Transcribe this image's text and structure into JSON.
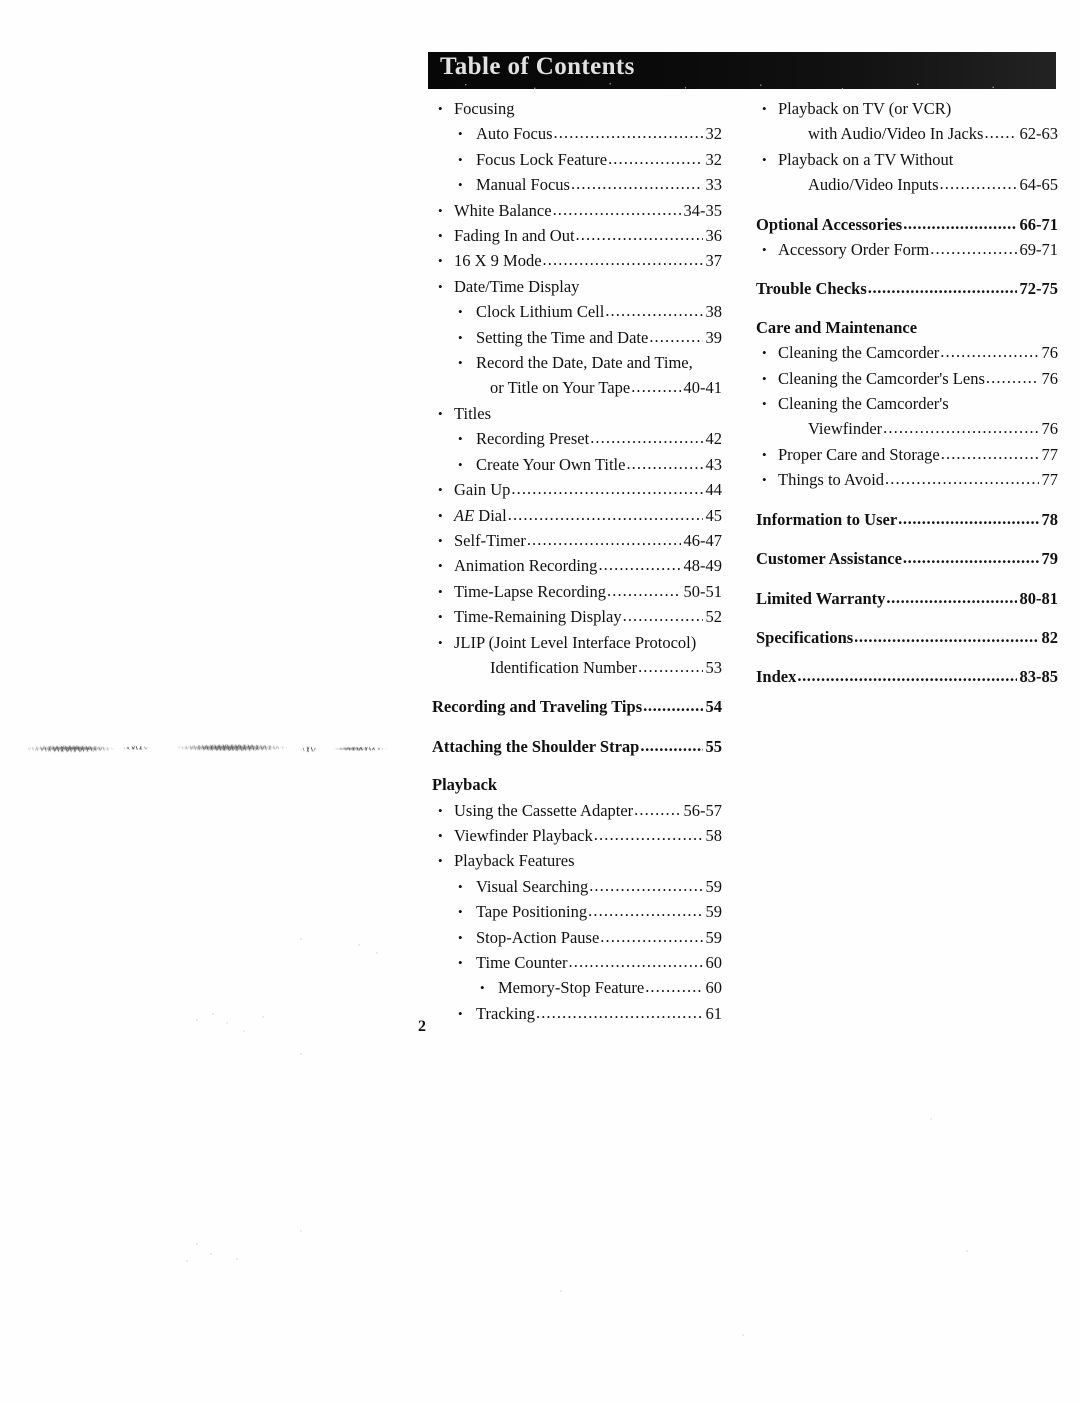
{
  "document": {
    "banner_title": "Table of Contents",
    "folio": "2",
    "leader_dots": "................................................................................................"
  },
  "left_column": [
    {
      "level": 1,
      "label": "Focusing",
      "page": ""
    },
    {
      "level": 2,
      "label": "Auto Focus",
      "page": "32"
    },
    {
      "level": 2,
      "label": "Focus Lock Feature",
      "page": "32"
    },
    {
      "level": 2,
      "label": "Manual Focus",
      "page": "33"
    },
    {
      "level": 1,
      "label": "White Balance",
      "page": "34-35"
    },
    {
      "level": 1,
      "label": "Fading In and Out",
      "page": "36"
    },
    {
      "level": 1,
      "label": "16 X 9 Mode",
      "page": "37"
    },
    {
      "level": 1,
      "label": "Date/Time Display",
      "page": ""
    },
    {
      "level": 2,
      "label": "Clock Lithium Cell",
      "page": "38"
    },
    {
      "level": 2,
      "label": "Setting the Time and Date",
      "page": "39"
    },
    {
      "level": 2,
      "label": "Record the Date, Date and  Time,",
      "page": ""
    },
    {
      "level": 0,
      "style": "cont",
      "label": "or Title on Your Tape",
      "page": "40-41"
    },
    {
      "level": 1,
      "label": "Titles",
      "page": ""
    },
    {
      "level": 2,
      "label": "Recording Preset",
      "page": "42"
    },
    {
      "level": 2,
      "label": "Create Your Own Title",
      "page": "43"
    },
    {
      "level": 1,
      "label": "Gain Up",
      "page": "44"
    },
    {
      "level": 1,
      "label_italic": "AE",
      "label": " Dial",
      "page": "45"
    },
    {
      "level": 1,
      "label": "Self-Timer",
      "page": "46-47"
    },
    {
      "level": 1,
      "label": "Animation Recording",
      "page": "48-49"
    },
    {
      "level": 1,
      "label": "Time-Lapse Recording",
      "page": "50-51"
    },
    {
      "level": 1,
      "label": "Time-Remaining Display",
      "page": "52"
    },
    {
      "level": 1,
      "label": "JLIP (Joint Level Interface Protocol)",
      "page": ""
    },
    {
      "level": 0,
      "style": "cont",
      "label": "Identification Number",
      "page": "53"
    },
    {
      "level": 0,
      "style": "head",
      "label": "Recording and Traveling Tips",
      "page": "54"
    },
    {
      "level": 0,
      "style": "head",
      "label": "Attaching the Shoulder Strap",
      "page": "55"
    },
    {
      "level": 0,
      "style": "head-nopg",
      "label": "Playback",
      "page": ""
    },
    {
      "level": 1,
      "label": "Using the Cassette Adapter",
      "page": "56-57"
    },
    {
      "level": 1,
      "label": "Viewfinder Playback",
      "page": "58"
    },
    {
      "level": 1,
      "label": "Playback  Features",
      "page": ""
    },
    {
      "level": 2,
      "label": "Visual Searching",
      "page": "59"
    },
    {
      "level": 2,
      "label": "Tape Positioning",
      "page": "59"
    },
    {
      "level": 2,
      "label": "Stop-Action Pause",
      "page": "59"
    },
    {
      "level": 2,
      "label": "Time Counter",
      "page": "60"
    },
    {
      "level": 3,
      "label": "Memory-Stop Feature",
      "page": "60"
    },
    {
      "level": 2,
      "label": "Tracking",
      "page": "61"
    }
  ],
  "right_column": [
    {
      "level": 1,
      "label": "Playback on TV (or VCR)",
      "page": ""
    },
    {
      "level": 0,
      "style": "cont-r",
      "label": "with Audio/Video In Jacks",
      "page": "62-63"
    },
    {
      "level": 1,
      "label": "Playback on a TV Without",
      "page": ""
    },
    {
      "level": 0,
      "style": "cont-r",
      "label": "Audio/Video Inputs",
      "page": "64-65"
    },
    {
      "level": 0,
      "style": "head",
      "label": "Optional Accessories",
      "page": "66-71"
    },
    {
      "level": 1,
      "label": "Accessory Order Form",
      "page": "69-71"
    },
    {
      "level": 0,
      "style": "head",
      "label": "Trouble Checks",
      "page": "72-75"
    },
    {
      "level": 0,
      "style": "head-nopg",
      "label": "Care and Maintenance",
      "page": ""
    },
    {
      "level": 1,
      "label": "Cleaning the Camcorder",
      "page": "76"
    },
    {
      "level": 1,
      "label": "Cleaning the Camcorder's Lens",
      "page": "76"
    },
    {
      "level": 1,
      "label": "Cleaning the Camcorder's",
      "page": ""
    },
    {
      "level": 0,
      "style": "cont-r",
      "label": "Viewfinder",
      "page": "76"
    },
    {
      "level": 1,
      "label": "Proper Care and Storage",
      "page": "77"
    },
    {
      "level": 1,
      "label": "Things to Avoid",
      "page": "77"
    },
    {
      "level": 0,
      "style": "head",
      "label": "Information to User",
      "page": "78"
    },
    {
      "level": 0,
      "style": "head",
      "label": "Customer Assistance",
      "page": "79"
    },
    {
      "level": 0,
      "style": "head",
      "label": "Limited Warranty",
      "page": "80-81"
    },
    {
      "level": 0,
      "style": "head",
      "label": "Specifications",
      "page": "82"
    },
    {
      "level": 0,
      "style": "head",
      "label": "Index",
      "page": "83-85"
    }
  ]
}
